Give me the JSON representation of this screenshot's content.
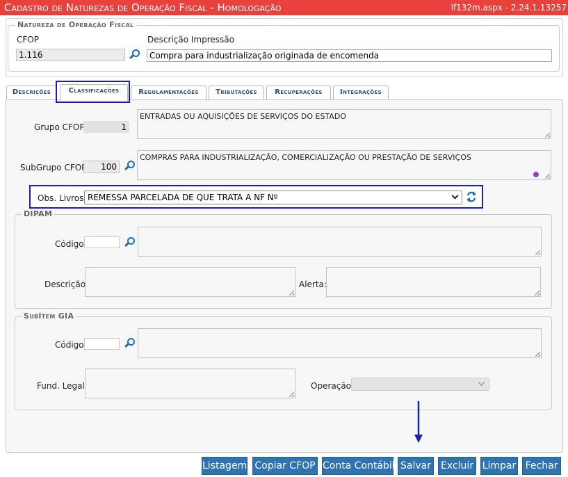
{
  "header": {
    "title": "Cadastro de Naturezas de Operação Fiscal   - Homologação",
    "page_info": "lf132m.aspx - 2.24.1.13257"
  },
  "natureza": {
    "legend": "Natureza de Operação Fiscal",
    "cfop_label": "CFOP",
    "cfop_value": "1.116",
    "descricao_label": "Descrição Impressão",
    "descricao_value": "Compra para industrialização originada de encomenda"
  },
  "tabs": [
    {
      "label": "Descrições"
    },
    {
      "label": "Classificações",
      "active": true
    },
    {
      "label": "Regulamentações"
    },
    {
      "label": "Tributações"
    },
    {
      "label": "Recuperações"
    },
    {
      "label": "Integrações"
    }
  ],
  "classificacoes": {
    "grupo_label": "Grupo CFOP:",
    "grupo_value": "1",
    "grupo_desc": "ENTRADAS OU AQUISIÇÕES DE SERVIÇOS DO ESTADO",
    "subgrupo_label": "SubGrupo CFOP:",
    "subgrupo_value": "100",
    "subgrupo_desc": "COMPRAS PARA INDUSTRIALIZAÇÃO, COMERCIALIZAÇÃO OU PRESTAÇÃO DE SERVIÇOS",
    "obs_label": "Obs. Livros:",
    "obs_value": "REMESSA PARCELADA DE QUE TRATA A NF Nº"
  },
  "dipam": {
    "legend": "DIPAM",
    "codigo_label": "Código:",
    "descricao_label": "Descrição:",
    "alerta_label": "Alerta:"
  },
  "subitem_gia": {
    "legend": "SubItem GIA",
    "codigo_label": "Código:",
    "fund_label": "Fund. Legal:",
    "operacao_label": "Operação:"
  },
  "buttons": {
    "listagem": "Listagem",
    "copiar": "Copiar CFOP",
    "conta": "Conta Contábil",
    "salvar": "Salvar",
    "excluir": "Excluir",
    "limpar": "Limpar",
    "fechar": "Fechar"
  },
  "colors": {
    "title_bar": "#e8413b",
    "button": "#2f73b0",
    "highlight": "#1b1fb0",
    "icon": "#1a6fb8"
  }
}
